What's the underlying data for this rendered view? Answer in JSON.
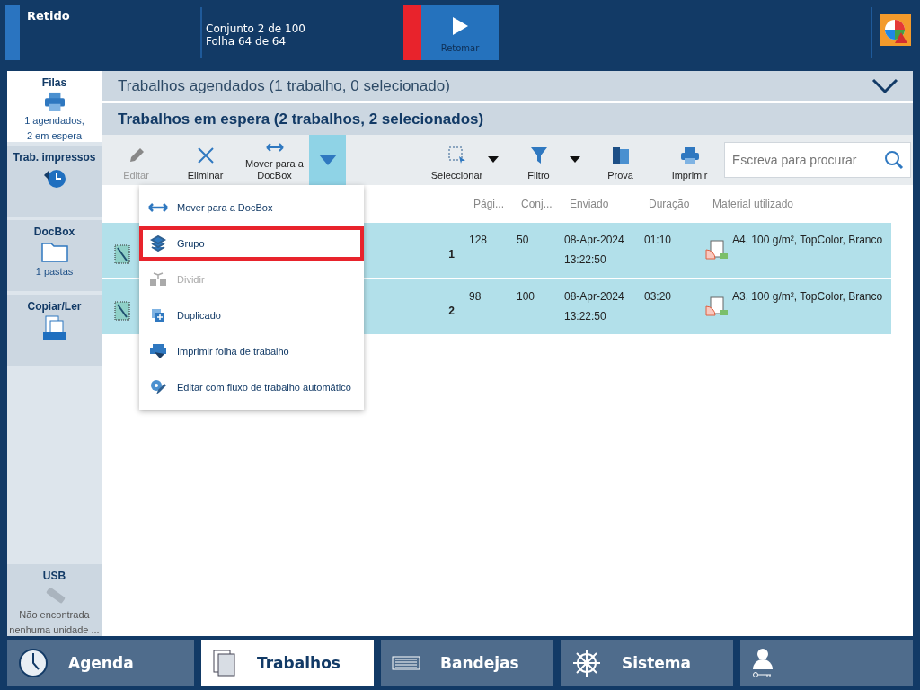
{
  "status_bar": {
    "state": "Retido",
    "progress": [
      "Conjunto 2 de 100",
      "Folha 64 de 64"
    ],
    "resume_button": "Retomar"
  },
  "sidebar": {
    "items": [
      {
        "kind": "queue",
        "label": "Filas",
        "lines": [
          "1 agendados,",
          "2 em espera"
        ],
        "selected": true
      },
      {
        "kind": "history",
        "label": "Trab. impressos",
        "selected": false
      },
      {
        "kind": "folder",
        "label": "DocBox",
        "lines": [
          "1 pastas"
        ],
        "selected": false
      },
      {
        "kind": "scan",
        "label": "Copiar/Ler",
        "selected": false
      }
    ],
    "usb": {
      "label": "USB",
      "lines": [
        "Não encontrada",
        "nenhuma unidade ..."
      ]
    }
  },
  "scheduled_header": "Trabalhos agendados (1 trabalho, 0 selecionado)",
  "waiting_header": "Trabalhos em espera (2 trabalhos, 2 selecionados)",
  "toolbar_left": [
    {
      "kind": "edit",
      "label": "Editar",
      "disabled": true
    },
    {
      "kind": "delete",
      "label": "Eliminar",
      "disabled": false
    },
    {
      "kind": "move",
      "label": "Mover para a DocBox",
      "disabled": false
    }
  ],
  "more_button": {
    "expanded": true
  },
  "toolbar_right": [
    {
      "kind": "select",
      "label": "Seleccionar",
      "has_caret": true
    },
    {
      "kind": "filter",
      "label": "Filtro",
      "has_caret": true
    },
    {
      "kind": "proof",
      "label": "Prova",
      "has_caret": false
    },
    {
      "kind": "print",
      "label": "Imprimir",
      "has_caret": false
    }
  ],
  "search": {
    "placeholder": "Escreva para procurar"
  },
  "table": {
    "columns": [
      "Pági...",
      "Conj...",
      "Enviado",
      "Duração",
      "Material utilizado"
    ],
    "rows": [
      {
        "number": "1",
        "pages": "128",
        "sets": "50",
        "sent": [
          "08-Apr-2024",
          "13:22:50"
        ],
        "duration": "01:10",
        "material": "A4, 100 g/m², TopColor, Branco",
        "selected": true
      },
      {
        "number": "2",
        "pages": "98",
        "sets": "100",
        "sent": [
          "08-Apr-2024",
          "13:22:50"
        ],
        "duration": "03:20",
        "material": "A3, 100 g/m², TopColor, Branco",
        "selected": true
      }
    ]
  },
  "menu": {
    "items": [
      {
        "kind": "move",
        "label": "Mover para a DocBox",
        "disabled": false,
        "highlighted": false
      },
      {
        "kind": "group",
        "label": "Grupo",
        "disabled": false,
        "highlighted": true
      },
      {
        "kind": "split",
        "label": "Dividir",
        "disabled": true,
        "highlighted": false
      },
      {
        "kind": "duplicate",
        "label": "Duplicado",
        "disabled": false,
        "highlighted": false
      },
      {
        "kind": "ticket",
        "label": "Imprimir folha de trabalho",
        "disabled": false,
        "highlighted": false
      },
      {
        "kind": "workflow",
        "label": "Editar com fluxo de trabalho automático",
        "disabled": false,
        "highlighted": false
      }
    ]
  },
  "nav": [
    {
      "kind": "clock",
      "label": "Agenda",
      "selected": false
    },
    {
      "kind": "jobs",
      "label": "Trabalhos",
      "selected": true
    },
    {
      "kind": "trays",
      "label": "Bandejas",
      "selected": false
    },
    {
      "kind": "system",
      "label": "Sistema",
      "selected": false
    },
    {
      "kind": "user",
      "selected": false
    }
  ]
}
